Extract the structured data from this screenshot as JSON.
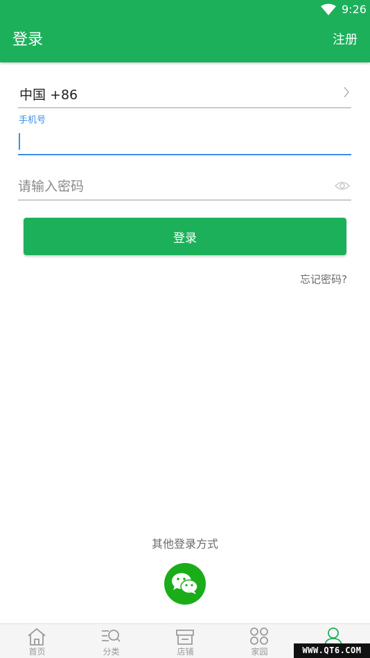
{
  "status_bar": {
    "time": "9:26",
    "wifi_icon": "wifi-icon"
  },
  "app_bar": {
    "title": "登录",
    "register": "注册"
  },
  "form": {
    "country": "中国 +86",
    "phone_label": "手机号",
    "phone_value": "",
    "password_placeholder": "请输入密码",
    "password_value": "",
    "login_button": "登录",
    "forgot_password": "忘记密码?"
  },
  "other_login": {
    "label": "其他登录方式",
    "icon": "wechat-icon"
  },
  "tab_bar": {
    "items": [
      {
        "label": "首页",
        "icon": "home-icon"
      },
      {
        "label": "分类",
        "icon": "category-icon"
      },
      {
        "label": "店铺",
        "icon": "store-icon"
      },
      {
        "label": "家园",
        "icon": "community-icon"
      },
      {
        "label": "",
        "icon": "user-icon",
        "active": true
      }
    ]
  },
  "watermark": "WWW.QT6.COM",
  "colors": {
    "primary": "#1db05b",
    "focus": "#3a8ee6",
    "wechat": "#1aad19",
    "muted": "#9a9a9a"
  }
}
